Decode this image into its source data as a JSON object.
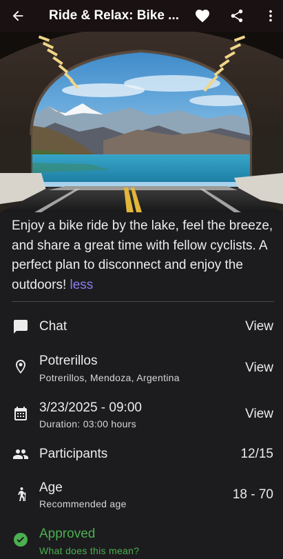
{
  "appbar": {
    "title": "Ride & Relax: Bike ...",
    "back_icon": "arrow-back-icon",
    "favorite_icon": "heart-icon",
    "share_icon": "share-icon",
    "more_icon": "more-vertical-icon"
  },
  "description": {
    "text": "Enjoy a bike ride by the lake, feel the breeze, and share a great time with fellow cyclists. A perfect plan to disconnect and enjoy the outdoors!",
    "less_label": "less"
  },
  "details": {
    "chat": {
      "title": "Chat",
      "action": "View"
    },
    "location": {
      "title": "Potrerillos",
      "subtitle": "Potrerillos, Mendoza, Argentina",
      "action": "View"
    },
    "date": {
      "title": "3/23/2025 - 09:00",
      "subtitle": "Duration: 03:00  hours",
      "action": "View"
    },
    "participants": {
      "title": "Participants",
      "value": "12/15"
    },
    "age": {
      "title": "Age",
      "subtitle": "Recommended age",
      "value": "18 - 70"
    },
    "status": {
      "title": "Approved",
      "subtitle": "What does this mean?"
    }
  },
  "colors": {
    "background": "#1c1c1e",
    "appbar": "#1a1212",
    "accent_link": "#8b7cf0",
    "approved_green": "#4caf50"
  }
}
